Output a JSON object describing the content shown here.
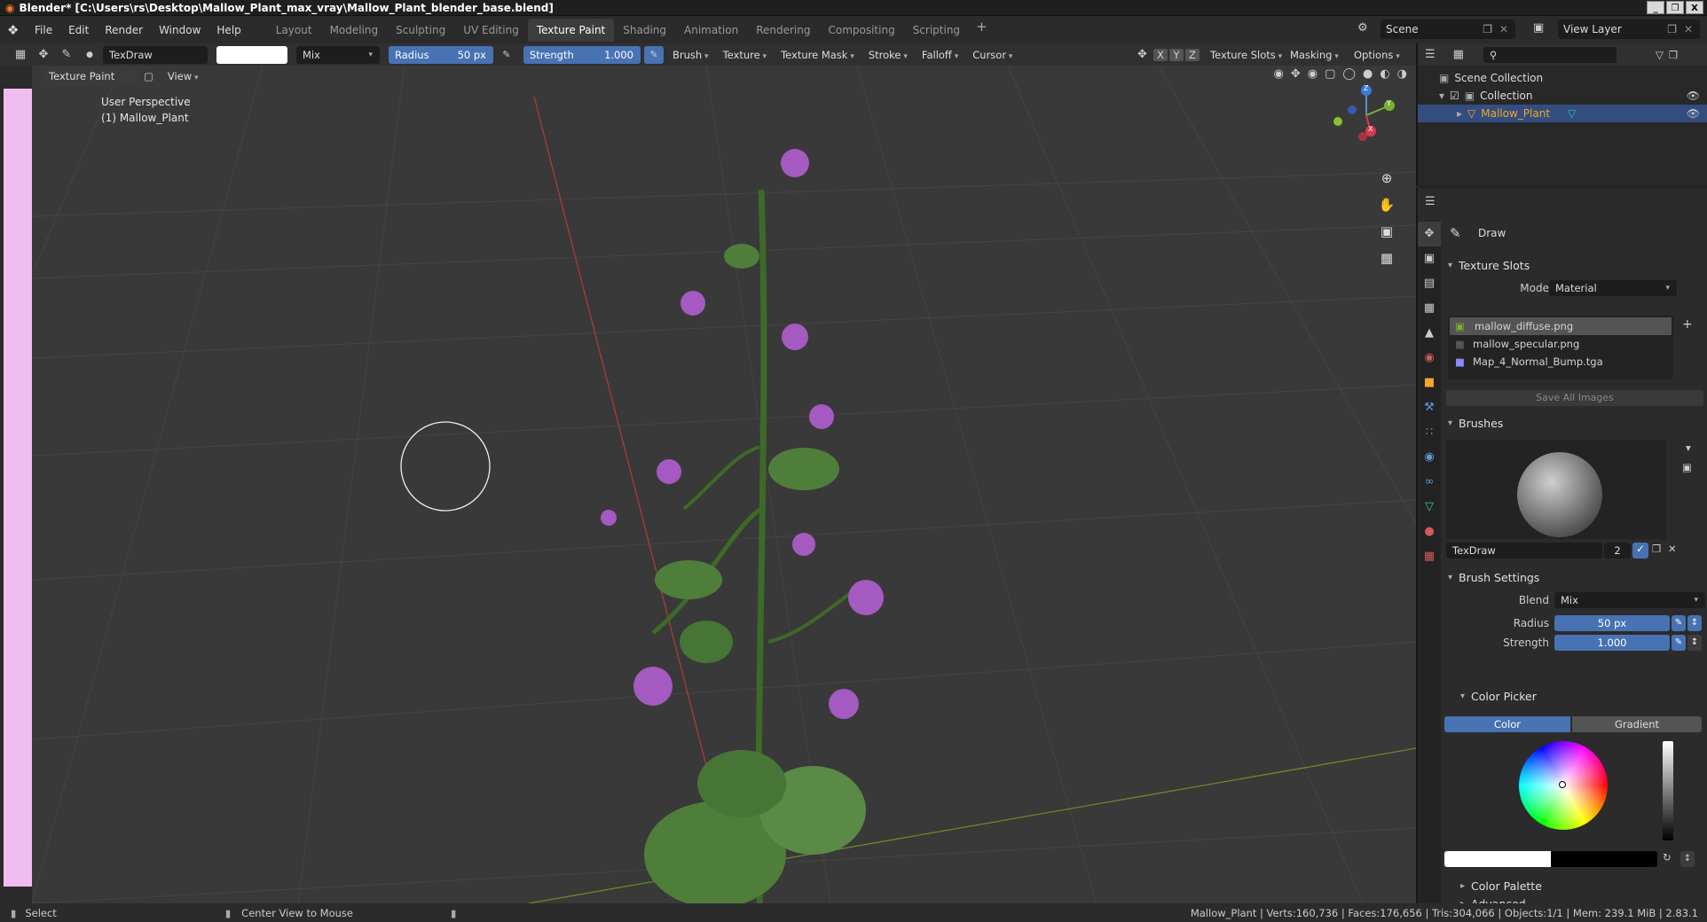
{
  "window": {
    "title": "Blender* [C:\\Users\\rs\\Desktop\\Mallow_Plant_max_vray\\Mallow_Plant_blender_base.blend]",
    "min": "_",
    "max": "❐",
    "close": "X"
  },
  "menu": [
    "File",
    "Edit",
    "Render",
    "Window",
    "Help"
  ],
  "workspaces": [
    "Layout",
    "Modeling",
    "Sculpting",
    "UV Editing",
    "Texture Paint",
    "Shading",
    "Animation",
    "Rendering",
    "Compositing",
    "Scripting"
  ],
  "active_workspace": "Texture Paint",
  "scene": {
    "label": "Scene",
    "view_layer": "View Layer"
  },
  "tool_header": {
    "brush": "TexDraw",
    "blend": "Mix",
    "radius_label": "Radius",
    "radius_value": "50 px",
    "strength_label": "Strength",
    "strength_value": "1.000",
    "menus": [
      "Brush",
      "Texture",
      "Texture Mask",
      "Stroke",
      "Falloff",
      "Cursor"
    ],
    "axes": [
      "X",
      "Y",
      "Z"
    ],
    "right_menus": [
      "Texture Slots",
      "Masking",
      "Options"
    ]
  },
  "view_header": {
    "mode": "Texture Paint",
    "view": "View"
  },
  "viewport": {
    "perspective": "User Perspective",
    "object": "(1) Mallow_Plant"
  },
  "gizmo": {
    "z": "Z",
    "y": "Y",
    "x": "X"
  },
  "outliner": {
    "root": "Scene Collection",
    "collection": "Collection",
    "object": "Mallow_Plant"
  },
  "properties": {
    "tool_name": "Draw",
    "texture_slots": {
      "title": "Texture Slots",
      "mode_label": "Mode",
      "mode_value": "Material",
      "slots": [
        "mallow_diffuse.png",
        "mallow_specular.png",
        "Map_4_Normal_Bump.tga"
      ],
      "save_button": "Save All Images"
    },
    "brushes": {
      "title": "Brushes",
      "brush_name": "TexDraw",
      "users": "2"
    },
    "brush_settings": {
      "title": "Brush Settings",
      "blend_label": "Blend",
      "blend_value": "Mix",
      "radius_label": "Radius",
      "radius_value": "50 px",
      "strength_label": "Strength",
      "strength_value": "1.000"
    },
    "color_picker": {
      "title": "Color Picker",
      "tabs": [
        "Color",
        "Gradient"
      ]
    },
    "color_palette": "Color Palette",
    "advanced": "Advanced"
  },
  "status": {
    "select": "Select",
    "center_view": "Center View to Mouse",
    "stats": "Mallow_Plant | Verts:160,736 | Faces:176,656 | Tris:304,066 | Objects:1/1 | Mem: 239.1 MiB | 2.83.1"
  },
  "colors": {
    "accent": "#4772b3",
    "viewport_bg": "#393939",
    "selected_row": "#334d80",
    "object_orange": "#f5a623"
  }
}
